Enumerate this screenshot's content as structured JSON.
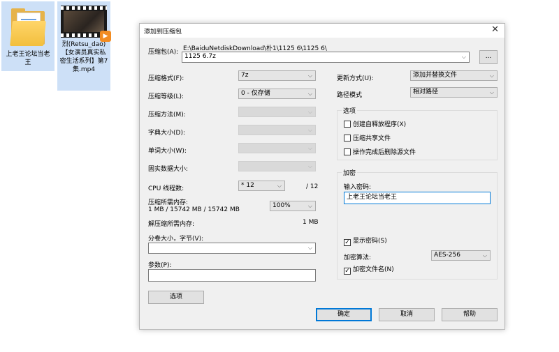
{
  "desktop": {
    "folder_label": "上老王论坛当老王",
    "video_label": "烈(Retsu_dao)【女演员真实私密生活系列】第7集.mp4"
  },
  "dialog": {
    "title": "添加到压缩包",
    "close_glyph": "✕",
    "archive_label": "压缩包(A):",
    "archive_path": "E:\\BaiduNetdiskDownload\\朴1\\1125 6\\1125 6\\",
    "archive_name": "1125 6.7z",
    "browse_label": "...",
    "format_label": "压缩格式(F):",
    "format_value": "7z",
    "level_label": "压缩等级(L):",
    "level_value": "0 - 仅存储",
    "method_label": "压缩方法(M):",
    "dict_label": "字典大小(D):",
    "word_label": "单词大小(W):",
    "solid_label": "固实数据大小:",
    "cpu_label": "CPU 线程数:",
    "cpu_value": "* 12",
    "cpu_total": "/ 12",
    "mem_comp_label": "压缩所需内存:",
    "mem_comp_value": "1 MB / 15742 MB / 15742 MB",
    "mem_pct_value": "100%",
    "mem_decomp_label": "解压缩所需内存:",
    "mem_decomp_value": "1 MB",
    "split_label": "分卷大小，字节(V):",
    "split_value": "",
    "params_label": "参数(P):",
    "params_value": "",
    "options_button": "选项",
    "update_label": "更新方式(U):",
    "update_value": "添加并替换文件",
    "path_label": "路径模式",
    "path_value": "相对路径",
    "options_group": "选项",
    "opt_sfx": "创建自释放程序(X)",
    "opt_shared": "压缩共享文件",
    "opt_delete": "操作完成后删除源文件",
    "encrypt_group": "加密",
    "password_label": "输入密码:",
    "password_value": "上老王论坛当老王",
    "show_password": "显示密码(S)",
    "algo_label": "加密算法:",
    "algo_value": "AES-256",
    "encrypt_names": "加密文件名(N)",
    "ok_button": "确定",
    "cancel_button": "取消",
    "help_button": "帮助",
    "check_glyph": "✓",
    "arrow_glyph": "⌵"
  }
}
